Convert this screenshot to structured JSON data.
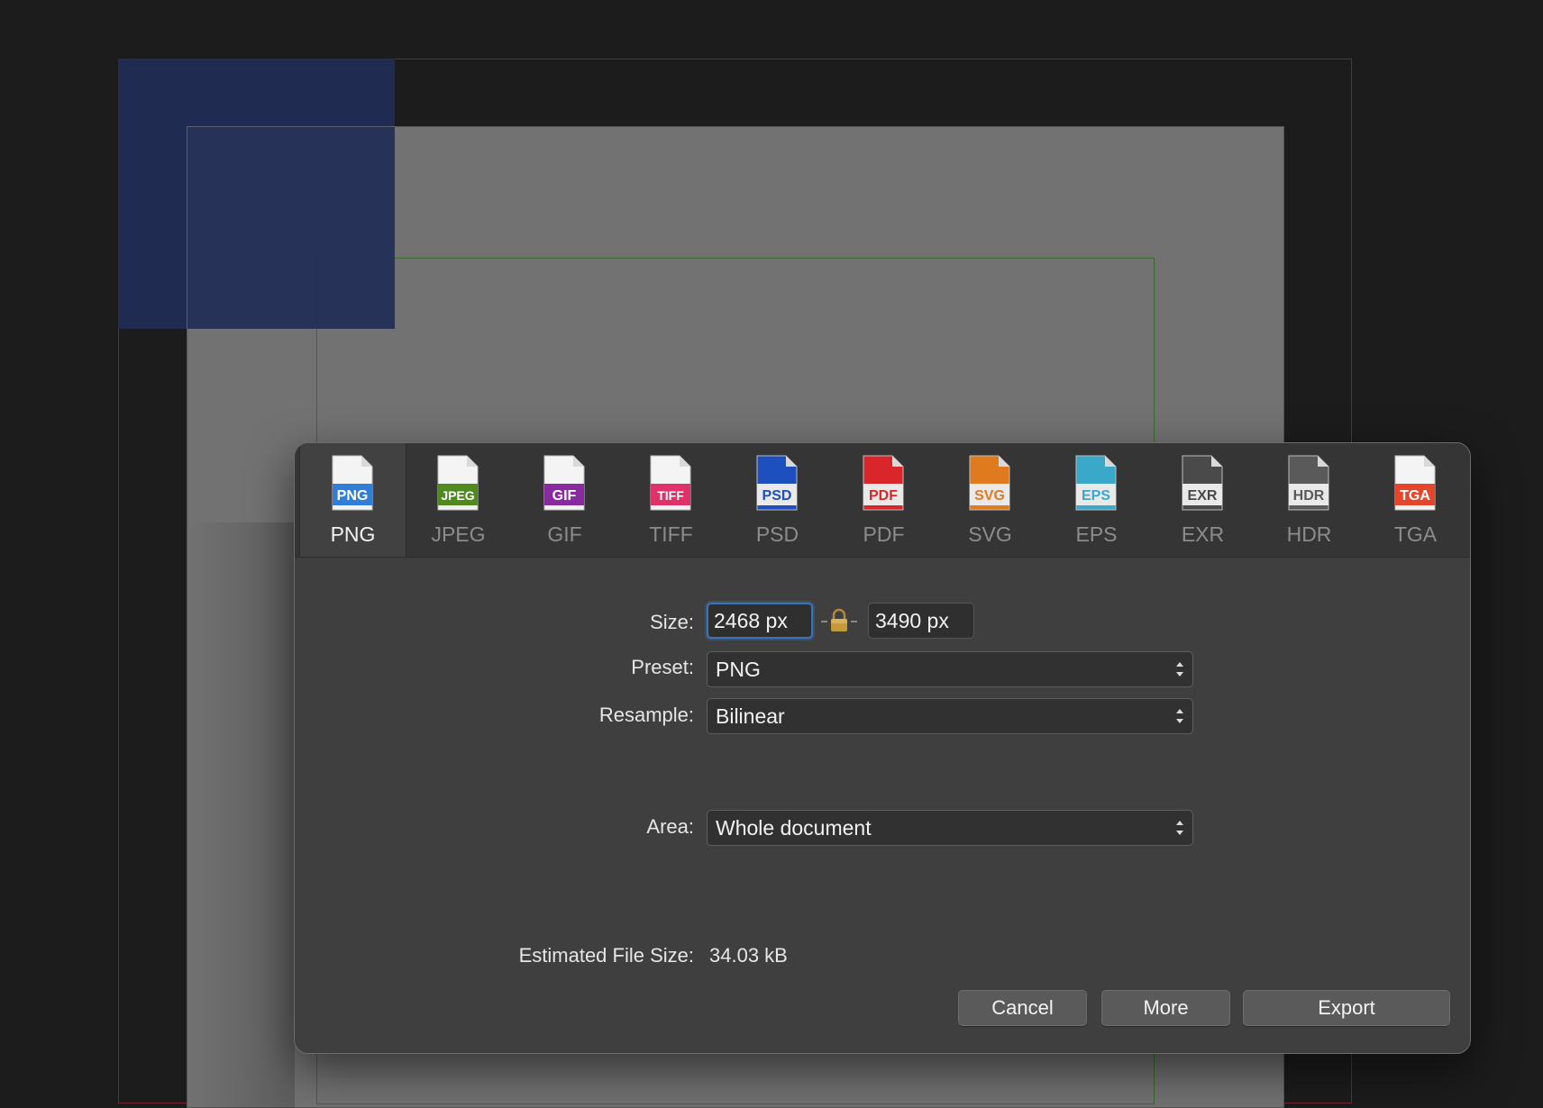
{
  "formats": [
    {
      "label": "PNG",
      "badge": "PNG",
      "color": "#2f7ed8",
      "selected": true
    },
    {
      "label": "JPEG",
      "badge": "JPEG",
      "color": "#4f8a1f",
      "selected": false
    },
    {
      "label": "GIF",
      "badge": "GIF",
      "color": "#8a2aa0",
      "selected": false
    },
    {
      "label": "TIFF",
      "badge": "TIFF",
      "color": "#e0326a",
      "selected": false
    },
    {
      "label": "PSD",
      "badge": "PSD",
      "color": "#1d4fbf",
      "selected": false
    },
    {
      "label": "PDF",
      "badge": "PDF",
      "color": "#d8262b",
      "selected": false
    },
    {
      "label": "SVG",
      "badge": "SVG",
      "color": "#e07a1f",
      "selected": false
    },
    {
      "label": "EPS",
      "badge": "EPS",
      "color": "#3aa9c9",
      "selected": false
    },
    {
      "label": "EXR",
      "badge": "EXR",
      "color": "#4a4a4a",
      "selected": false
    },
    {
      "label": "HDR",
      "badge": "HDR",
      "color": "#5a5a5a",
      "selected": false
    },
    {
      "label": "TGA",
      "badge": "TGA",
      "color": "#e5462a",
      "selected": false
    }
  ],
  "size": {
    "label": "Size:",
    "width": "2468 px",
    "height": "3490 px",
    "lock_icon": "lock-icon"
  },
  "preset": {
    "label": "Preset:",
    "value": "PNG"
  },
  "resample": {
    "label": "Resample:",
    "value": "Bilinear"
  },
  "area": {
    "label": "Area:",
    "value": "Whole document"
  },
  "estimate": {
    "label": "Estimated File Size:",
    "value": "34.03 kB"
  },
  "buttons": {
    "cancel": "Cancel",
    "more": "More",
    "export": "Export"
  },
  "colors": {
    "dialog_bg": "#3f3f40",
    "focus_ring": "#3b74b5",
    "canvas_bg": "#1c1c1d",
    "page": "#727272",
    "selection": "#212c56"
  }
}
